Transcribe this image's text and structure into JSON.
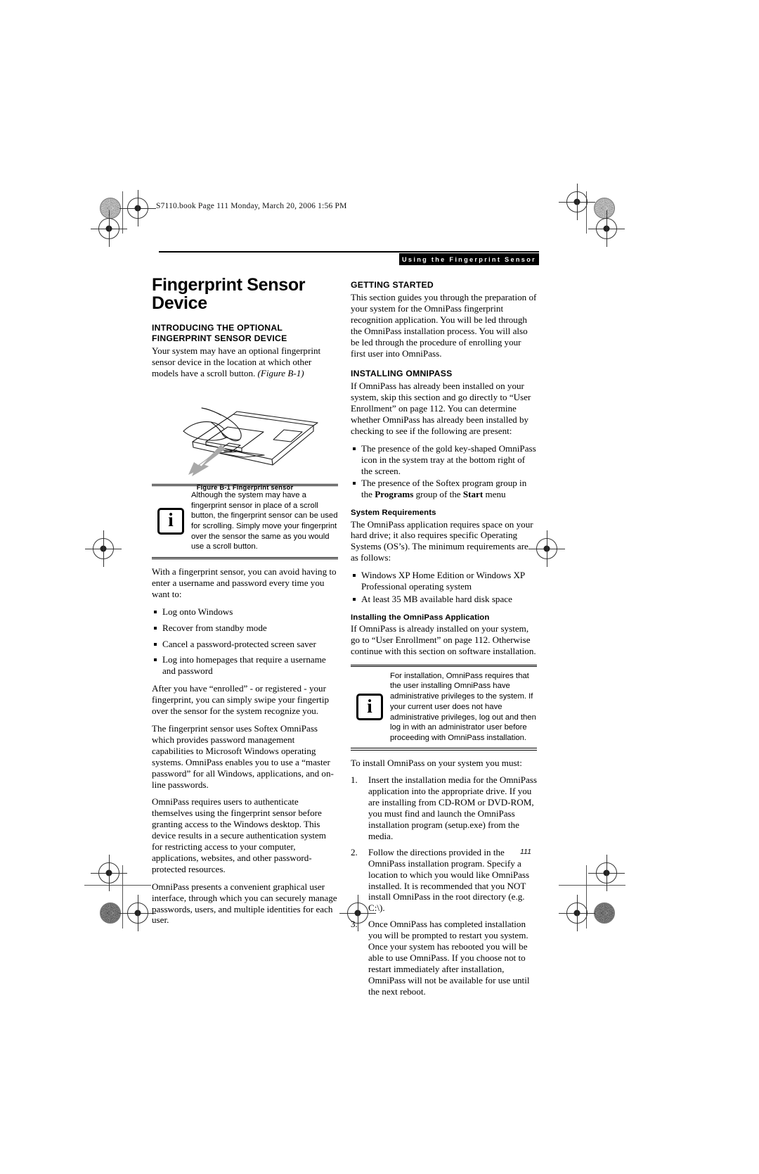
{
  "slug": "S7110.book  Page 111  Monday, March 20, 2006  1:56 PM",
  "header": {
    "running_head": "Using the Fingerprint Sensor"
  },
  "page_number": "111",
  "left_column": {
    "title": "Fingerprint Sensor Device",
    "section_heading": "INTRODUCING THE OPTIONAL FINGERPRINT SENSOR DEVICE",
    "intro_text": "Your system may have an optional fingerprint sensor device in the location at which other models have a scroll button. ",
    "intro_ref": "(Figure B-1)",
    "figure_caption": "Figure B-1  Fingerprint sensor",
    "note": {
      "icon": "information-i-icon",
      "text": "Although the system may have a fingerprint sensor in place of a scroll button, the fingerprint sensor can be used for scrolling. Simply move your fingerprint over the sensor the same as you would use a scroll button."
    },
    "para_avoid": "With a fingerprint sensor, you can avoid having to enter a username and password every time you want to:",
    "bullets": [
      "Log onto Windows",
      "Recover from standby mode",
      "Cancel a password-protected screen saver",
      "Log into homepages that require a username and password"
    ],
    "para_enrolled": "After you have “enrolled” - or registered - your fingerprint, you can simply swipe your fingertip over the sensor for the system recognize you.",
    "para_softex": "The fingerprint sensor uses Softex OmniPass which provides password management capabilities to Microsoft Windows operating systems. OmniPass enables you to use a “master password” for all Windows, applications, and on-line passwords.",
    "para_authenticate": "OmniPass requires users to authenticate themselves using the fingerprint sensor before granting access to the Windows desktop. This device results in a secure authentication system for restricting access to your computer, applications, websites, and other password-protected resources.",
    "para_interface": "OmniPass presents a convenient graphical user interface, through which you can securely manage passwords, users, and multiple identities for each user."
  },
  "right_column": {
    "getting_started_heading": "GETTING STARTED",
    "getting_started_text": "This section guides you through the preparation of your system for the OmniPass fingerprint recognition application. You will be led through the OmniPass installation process. You will also be led through the procedure of enrolling your first user into OmniPass.",
    "installing_heading": "INSTALLING OMNIPASS",
    "installing_text": "If OmniPass has already been installed on your system, skip this section and go directly to “User Enrollment” on page 112. You can determine whether OmniPass has already been installed by checking to see if the following are present:",
    "installing_bullets": [
      "The presence of the gold key-shaped OmniPass icon in the system tray at the bottom right of the screen.",
      "The presence of the Softex program group in the Programs group of the Start menu"
    ],
    "installing_bullet2_parts": {
      "pre": "The presence of the Softex program group in the ",
      "bold1": "Programs",
      "mid": " group of the ",
      "bold2": "Start",
      "post": " menu"
    },
    "sysreq_heading": "System Requirements",
    "sysreq_text": "The OmniPass application requires space on your hard drive; it also requires specific Operating Systems (OS’s). The minimum requirements are as follows:",
    "sysreq_bullets": [
      "Windows XP Home Edition or Windows XP Professional operating system",
      "At least 35 MB available hard disk space"
    ],
    "install_app_heading": "Installing the OmniPass Application",
    "install_app_text": "If OmniPass is already installed on your system, go to “User Enrollment” on page 112. Otherwise continue with this section on software installation.",
    "note": {
      "icon": "information-i-icon",
      "text": "For installation, OmniPass requires that the user installing OmniPass have administrative privileges to the system. If your current user does not have administrative privileges, log out and then log in with an administrator user before proceeding with OmniPass installation."
    },
    "to_install_text": "To install OmniPass on your system you must:",
    "steps": [
      "Insert the installation media for the OmniPass application into the appropriate drive. If you are installing from CD-ROM or DVD-ROM, you must find and launch the OmniPass installation program (setup.exe) from the media.",
      "Follow the directions provided in the OmniPass installation program. Specify a location to which you would like OmniPass installed. It is recommended that you NOT install OmniPass in the root directory (e.g. C:\\).",
      "Once OmniPass has completed installation you will be prompted to restart you system. Once your system has rebooted you will be able to use OmniPass. If you choose not to restart immediately after installation, OmniPass will not be available for use until the next reboot."
    ]
  },
  "figure": {
    "name": "laptop-touchpad-fingerprint-sensor-illustration",
    "arrow_color": "#a8a8a8",
    "line_color": "#1a1a1a"
  }
}
